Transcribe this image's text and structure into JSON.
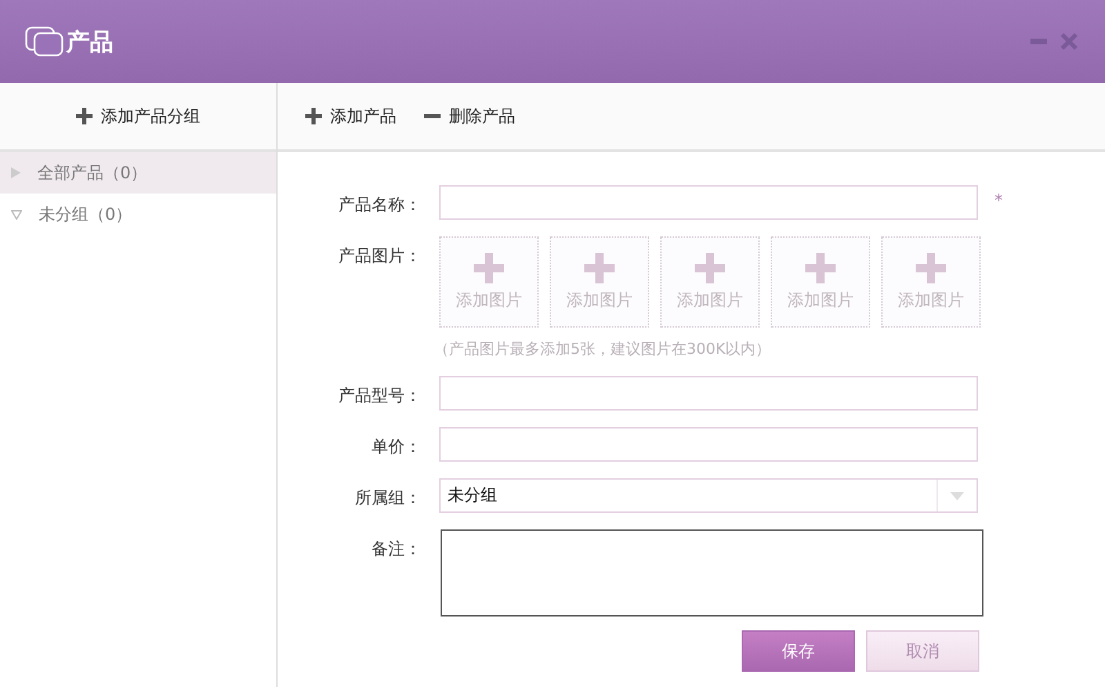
{
  "window": {
    "title": "产品"
  },
  "sidebar": {
    "add_button": "添加产品分组",
    "items": [
      {
        "label": "全部产品（0）",
        "selected": true,
        "expanded": false
      },
      {
        "label": "未分组（0）",
        "selected": false,
        "expanded": true
      }
    ]
  },
  "toolbar": [
    {
      "kind": "add",
      "label": "添加产品"
    },
    {
      "kind": "remove",
      "label": "删除产品"
    }
  ],
  "form": {
    "fields": [
      {
        "kind": "text",
        "label": "产品名称：",
        "required_mark": "*"
      },
      {
        "kind": "images",
        "label": "产品图片：",
        "slots": [
          "添加图片",
          "添加图片",
          "添加图片",
          "添加图片",
          "添加图片"
        ],
        "hint": "（产品图片最多添加5张，建议图片在300K以内）"
      },
      {
        "kind": "text",
        "label": "产品型号："
      },
      {
        "kind": "text",
        "label": "单价："
      },
      {
        "kind": "select",
        "label": "所属组：",
        "value": "未分组"
      },
      {
        "kind": "textarea",
        "label": "备注："
      }
    ],
    "buttons": [
      {
        "kind": "primary",
        "label": "保存"
      },
      {
        "kind": "secondary",
        "label": "取消"
      }
    ]
  }
}
